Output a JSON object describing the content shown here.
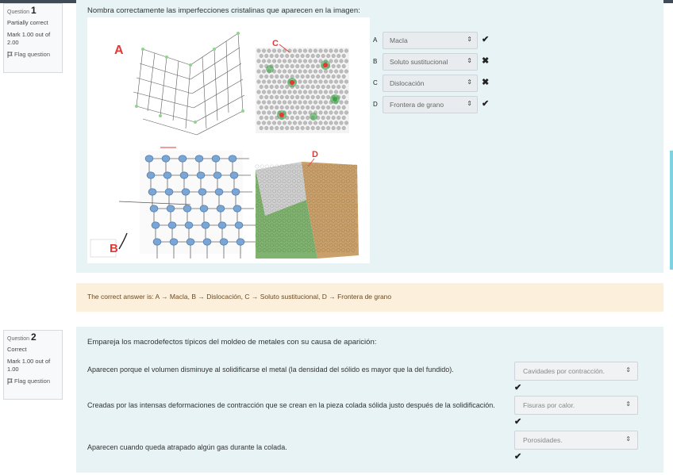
{
  "q1": {
    "number_prefix": "Question",
    "number": "1",
    "state": "Partially correct",
    "grade": "Mark 1.00 out of 2.00",
    "flag": "Flag question",
    "text": "Nombra correctamente las imperfecciones cristalinas que aparecen en la imagen:",
    "image_labels": {
      "a": "A",
      "b": "B",
      "c": "C",
      "d": "D"
    },
    "answers": [
      {
        "label": "A",
        "value": "Macla",
        "mark": "✔"
      },
      {
        "label": "B",
        "value": "Soluto sustitucional",
        "mark": "✖"
      },
      {
        "label": "C",
        "value": "Dislocación",
        "mark": "✖"
      },
      {
        "label": "D",
        "value": "Frontera de grano",
        "mark": "✔"
      }
    ],
    "feedback": "The correct answer is: A → Macla, B → Dislocación, C → Soluto sustitucional, D → Frontera de grano"
  },
  "q2": {
    "number_prefix": "Question",
    "number": "2",
    "state": "Correct",
    "grade": "Mark 1.00 out of 1.00",
    "flag": "Flag question",
    "text": "Empareja los macrodefectos típicos del moldeo de metales con su causa de aparición:",
    "rows": [
      {
        "text": "Aparecen porque el volumen disminuye al solidificarse el metal (la densidad del sólido es mayor que la del fundido).",
        "value": "Cavidades por contracción.",
        "mark": "✔"
      },
      {
        "text": "Creadas por las intensas deformaciones de contracción que se crean en la pieza colada sólida justo después de la solidificación.",
        "value": "Fisuras por calor.",
        "mark": "✔"
      },
      {
        "text": "Aparecen cuando queda atrapado algún gas durante la colada.",
        "value": "Porosidades.",
        "mark": "✔"
      }
    ]
  },
  "colors": {
    "accent_red": "#e53935",
    "correct": "#1f1f1f",
    "feedback_bg": "#fcefdc",
    "panel_bg": "#e7f3f5"
  }
}
